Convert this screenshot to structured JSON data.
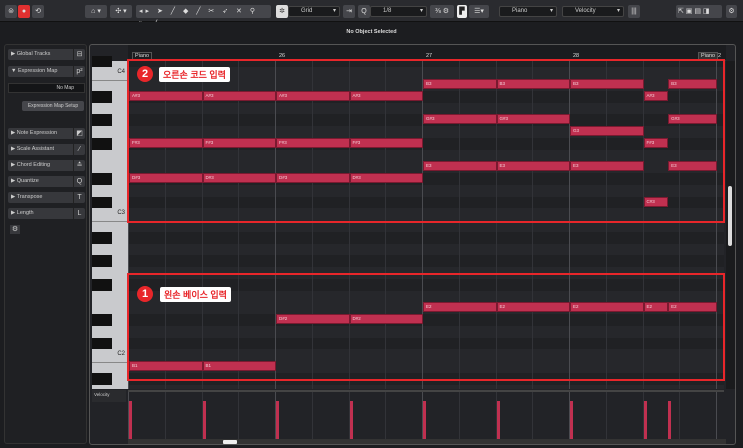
{
  "toolbar": {
    "snap_type": "Grid",
    "quantize": "1/8",
    "instrument": "Piano",
    "lane": "Velocity"
  },
  "status": "No Object Selected",
  "inspector": {
    "sections": [
      {
        "label": "Global Tracks",
        "icon": "layout-icon",
        "glyph": "⊟"
      },
      {
        "label": "Expression Map",
        "icon": "expression-icon",
        "glyph": "p²"
      },
      {
        "label": "Note Expression",
        "icon": "note-expression-icon",
        "glyph": "◩"
      },
      {
        "label": "Scale Assistant",
        "icon": "scale-icon",
        "glyph": "⁄"
      },
      {
        "label": "Chord Editing",
        "icon": "chord-icon",
        "glyph": "≛"
      },
      {
        "label": "Quantize",
        "icon": "quantize-icon",
        "glyph": "Q"
      },
      {
        "label": "Transpose",
        "icon": "transpose-icon",
        "glyph": "T"
      },
      {
        "label": "Length",
        "icon": "length-icon",
        "glyph": "L"
      }
    ],
    "map_select": "No Map",
    "map_setup": "Expression Map Setup"
  },
  "ruler": {
    "part_label": "Piano",
    "bars": [
      "26",
      "27",
      "28"
    ],
    "right_part": "Piano",
    "right_bar": "2"
  },
  "keys": {
    "c4": "C4",
    "c3": "C3",
    "c2": "C2"
  },
  "velocity_label": "Velocity",
  "annotations": {
    "a2": {
      "num": "2",
      "text": "오른손 코드 입력"
    },
    "a1": {
      "num": "1",
      "text": "왼손 베이스 입력"
    }
  },
  "colors": {
    "note": "#c03050",
    "annotation": "#e8262a"
  },
  "notes": [
    {
      "p": "A#3",
      "m": 58,
      "s": 0,
      "e": 2
    },
    {
      "p": "A#3",
      "m": 58,
      "s": 2,
      "e": 4
    },
    {
      "p": "A#3",
      "m": 58,
      "s": 4,
      "e": 6
    },
    {
      "p": "A#3",
      "m": 58,
      "s": 6,
      "e": 8
    },
    {
      "p": "F#3",
      "m": 54,
      "s": 0,
      "e": 2
    },
    {
      "p": "F#3",
      "m": 54,
      "s": 2,
      "e": 4
    },
    {
      "p": "F#3",
      "m": 54,
      "s": 4,
      "e": 6
    },
    {
      "p": "F#3",
      "m": 54,
      "s": 6,
      "e": 8
    },
    {
      "p": "D#3",
      "m": 51,
      "s": 0,
      "e": 2
    },
    {
      "p": "D#3",
      "m": 51,
      "s": 2,
      "e": 4
    },
    {
      "p": "D#3",
      "m": 51,
      "s": 4,
      "e": 6
    },
    {
      "p": "D#3",
      "m": 51,
      "s": 6,
      "e": 8
    },
    {
      "p": "B3",
      "m": 59,
      "s": 8,
      "e": 10
    },
    {
      "p": "B3",
      "m": 59,
      "s": 10,
      "e": 12
    },
    {
      "p": "B3",
      "m": 59,
      "s": 12,
      "e": 14
    },
    {
      "p": "A#3",
      "m": 58,
      "s": 14,
      "e": 14.67
    },
    {
      "p": "B3",
      "m": 59,
      "s": 14.67,
      "e": 16
    },
    {
      "p": "G#3",
      "m": 56,
      "s": 8,
      "e": 10
    },
    {
      "p": "G#3",
      "m": 56,
      "s": 10,
      "e": 12
    },
    {
      "p": "G3",
      "m": 55,
      "s": 12,
      "e": 14
    },
    {
      "p": "F#3",
      "m": 54,
      "s": 14,
      "e": 14.67
    },
    {
      "p": "G#3",
      "m": 56,
      "s": 14.67,
      "e": 16
    },
    {
      "p": "E3",
      "m": 52,
      "s": 8,
      "e": 10
    },
    {
      "p": "E3",
      "m": 52,
      "s": 10,
      "e": 12
    },
    {
      "p": "E3",
      "m": 52,
      "s": 12,
      "e": 14
    },
    {
      "p": "C#3",
      "m": 49,
      "s": 14,
      "e": 14.67
    },
    {
      "p": "E3",
      "m": 52,
      "s": 14.67,
      "e": 16
    },
    {
      "p": "B1",
      "m": 35,
      "s": 0,
      "e": 2
    },
    {
      "p": "B1",
      "m": 35,
      "s": 2,
      "e": 4
    },
    {
      "p": "D#2",
      "m": 39,
      "s": 4,
      "e": 6
    },
    {
      "p": "D#2",
      "m": 39,
      "s": 6,
      "e": 8
    },
    {
      "p": "E2",
      "m": 40,
      "s": 8,
      "e": 10
    },
    {
      "p": "E2",
      "m": 40,
      "s": 10,
      "e": 12
    },
    {
      "p": "E2",
      "m": 40,
      "s": 12,
      "e": 14
    },
    {
      "p": "E2",
      "m": 40,
      "s": 14,
      "e": 14.67
    },
    {
      "p": "E2",
      "m": 40,
      "s": 14.67,
      "e": 16
    }
  ]
}
